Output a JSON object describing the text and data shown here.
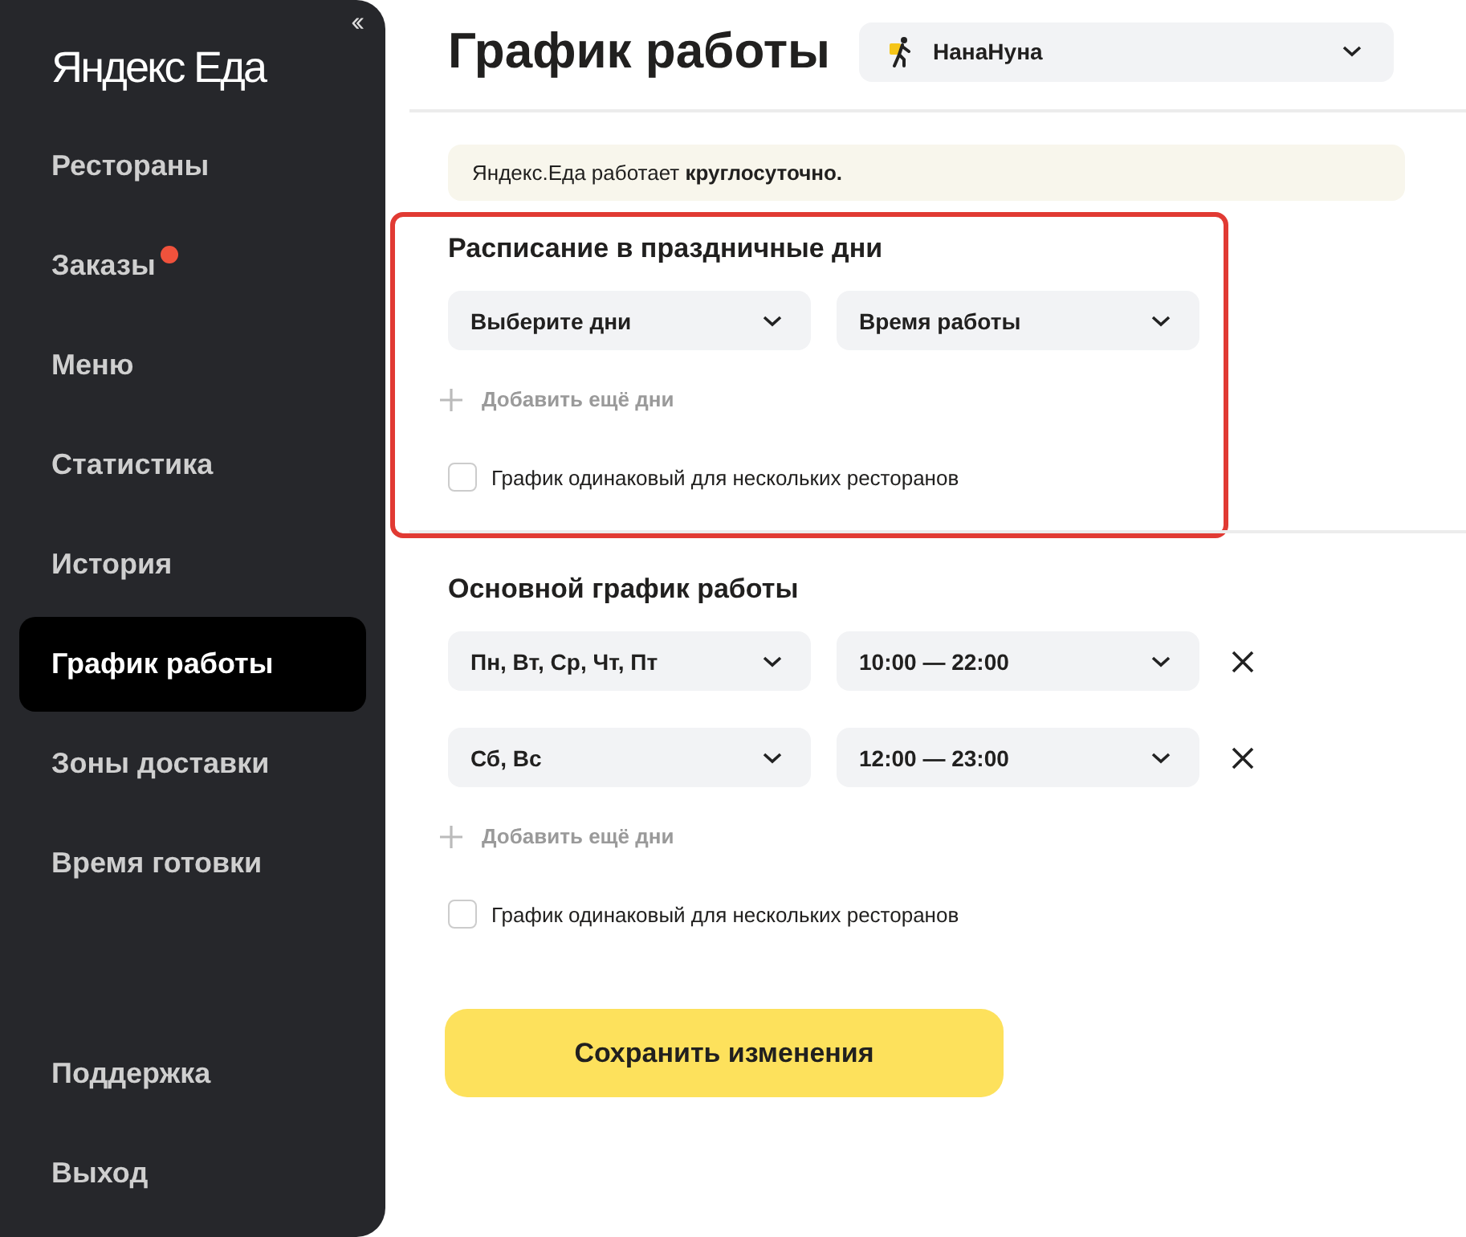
{
  "sidebar": {
    "logo": "Яндекс Еда",
    "collapse_icon": "‹‹",
    "items": [
      {
        "label": "Рестораны",
        "selected": false,
        "unread": false
      },
      {
        "label": "Заказы",
        "selected": false,
        "unread": true
      },
      {
        "label": "Меню",
        "selected": false,
        "unread": false
      },
      {
        "label": "Статистика",
        "selected": false,
        "unread": false
      },
      {
        "label": "История",
        "selected": false,
        "unread": false
      },
      {
        "label": "График работы",
        "selected": true,
        "unread": false
      },
      {
        "label": "Зоны доставки",
        "selected": false,
        "unread": false
      },
      {
        "label": "Время готовки",
        "selected": false,
        "unread": false
      }
    ],
    "footer_items": [
      {
        "label": "Поддержка",
        "selected": false
      },
      {
        "label": "Выход",
        "selected": false
      }
    ]
  },
  "header": {
    "title": "График работы",
    "restaurant_select": {
      "value": "НанаНуна"
    }
  },
  "notice": "Яндекс.Еда работает **круглосуточно.**",
  "sections": [
    {
      "title": "Расписание в праздничные дни",
      "highlighted": true,
      "rows": [
        {
          "days": {
            "placeholder": "Выберите дни"
          },
          "hours": {
            "placeholder": "Время работы"
          },
          "removable": false
        }
      ],
      "add_label": "Добавить ещё дни",
      "same_schedule": {
        "label": "График одинаковый для нескольких ресторанов",
        "checked": false
      }
    },
    {
      "title": "Основной график работы",
      "highlighted": false,
      "rows": [
        {
          "days": {
            "value": "Пн, Вт, Ср, Чт, Пт"
          },
          "hours": {
            "value": "10:00 — 22:00"
          },
          "removable": true
        },
        {
          "days": {
            "value": "Сб, Вс"
          },
          "hours": {
            "value": "12:00 — 23:00"
          },
          "removable": true
        }
      ],
      "add_label": "Добавить ещё дни",
      "same_schedule": {
        "label": "График одинаковый для нескольких ресторанов",
        "checked": false
      }
    }
  ],
  "save_button": "Сохранить изменения"
}
